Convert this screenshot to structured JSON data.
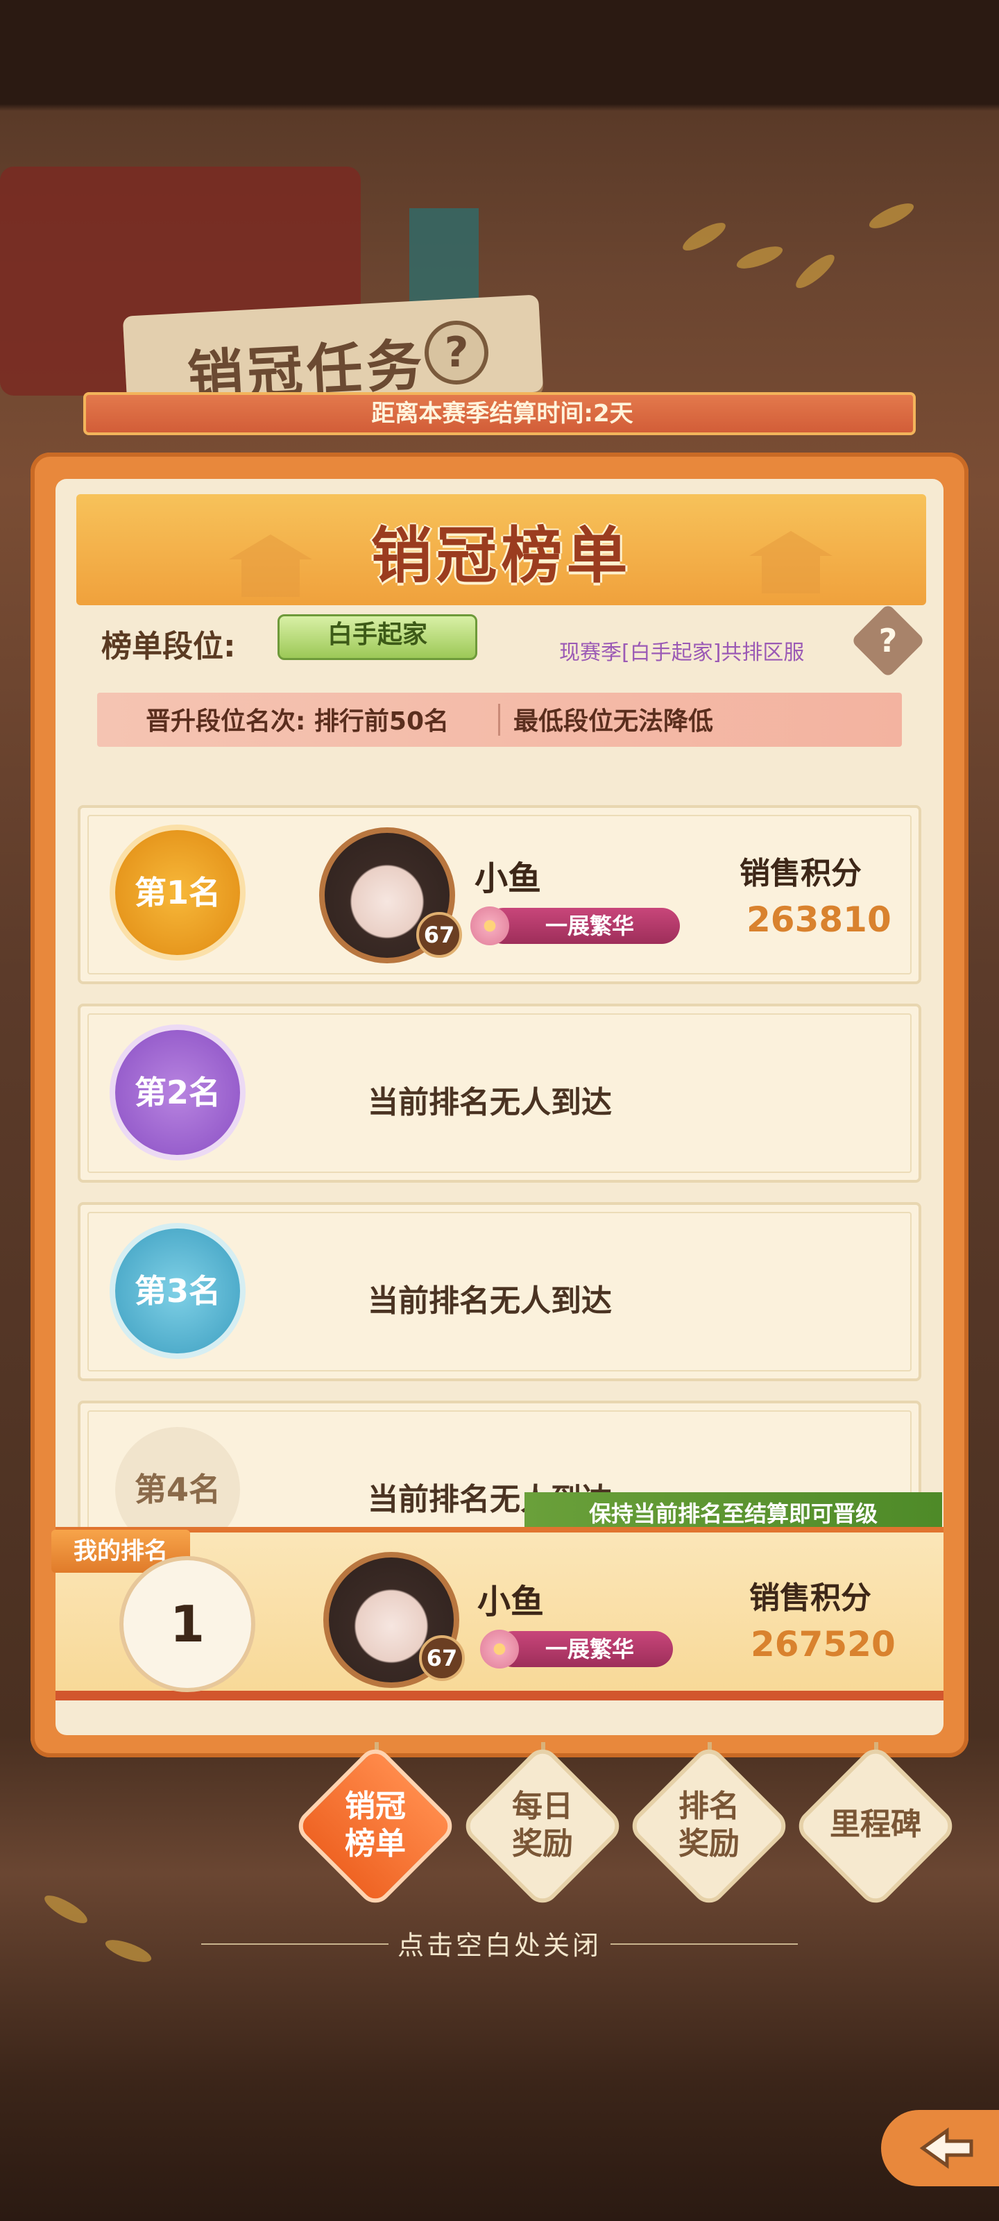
{
  "scene": {
    "board_title": "销冠任务",
    "board_help_icon": "question-icon"
  },
  "season": {
    "countdown_text": "距离本赛季结算时间:2天"
  },
  "panel": {
    "title": "销冠榜单",
    "tier_label": "榜单段位:",
    "tier_value": "白手起家",
    "tier_note": "现赛季[白手起家]共排区服",
    "help_icon": "question-icon",
    "promo_left": "晋升段位名次: 排行前50名",
    "promo_right": "最低段位无法降低"
  },
  "ranks": [
    {
      "medal": "第1名",
      "medal_color": "#f2a21c",
      "player_name": "小鱼",
      "level": "67",
      "title": "一展繁华",
      "score_label": "销售积分",
      "score": "263810"
    },
    {
      "medal": "第2名",
      "medal_color": "#a466d6",
      "empty_text": "当前排名无人到达"
    },
    {
      "medal": "第3名",
      "medal_color": "#4fb8d8",
      "empty_text": "当前排名无人到达"
    },
    {
      "medal": "第4名",
      "medal_color": "#e8d8c0",
      "empty_text": "当前排名无人到达"
    }
  ],
  "my_rank": {
    "tag": "我的排名",
    "keep_tip": "保持当前排名至结算即可晋级",
    "rank": "1",
    "player_name": "小鱼",
    "level": "67",
    "title": "一展繁华",
    "score_label": "销售积分",
    "score": "267520"
  },
  "tabs": [
    {
      "label": "销冠\n榜单",
      "active": true
    },
    {
      "label": "每日\n奖励",
      "active": false
    },
    {
      "label": "排名\n奖励",
      "active": false
    },
    {
      "label": "里程碑",
      "active": false
    }
  ],
  "close_hint": "点击空白处关闭",
  "back_icon": "back-arrow-icon"
}
